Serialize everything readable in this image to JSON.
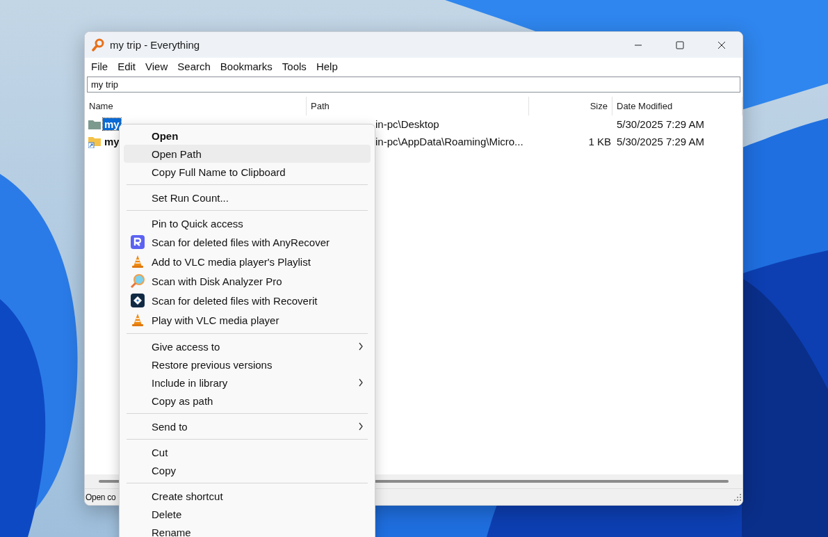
{
  "window": {
    "title": "my trip - Everything"
  },
  "menu_bar": [
    "File",
    "Edit",
    "View",
    "Search",
    "Bookmarks",
    "Tools",
    "Help"
  ],
  "search": {
    "value": "my trip"
  },
  "table": {
    "columns": [
      "Name",
      "Path",
      "Size",
      "Date Modified"
    ],
    "rows": [
      {
        "kind": "folder",
        "name": "my",
        "path": "in-pc\\Desktop",
        "size": "",
        "date": "5/30/2025 7:29 AM",
        "selected": true
      },
      {
        "kind": "shortcut",
        "name": "my",
        "path": "in-pc\\AppData\\Roaming\\Micro...",
        "size": "1 KB",
        "date": "5/30/2025 7:29 AM",
        "selected": false
      }
    ]
  },
  "status_bar": "Open co",
  "context_menu": [
    {
      "kind": "plain",
      "label": "Open",
      "default": true,
      "highlighted": false,
      "submenu": false
    },
    {
      "kind": "plain",
      "label": "Open Path",
      "default": false,
      "highlighted": true,
      "submenu": false
    },
    {
      "kind": "plain",
      "label": "Copy Full Name to Clipboard",
      "default": false,
      "highlighted": false,
      "submenu": false
    },
    {
      "kind": "separator"
    },
    {
      "kind": "plain",
      "label": "Set Run Count...",
      "default": false,
      "highlighted": false,
      "submenu": false
    },
    {
      "kind": "separator"
    },
    {
      "kind": "plain",
      "label": "Pin to Quick access",
      "default": false,
      "highlighted": false,
      "submenu": false
    },
    {
      "kind": "rtile",
      "label": "Scan for deleted files with AnyRecover",
      "default": false,
      "highlighted": false,
      "submenu": false
    },
    {
      "kind": "cone",
      "label": "Add to VLC media player's Playlist",
      "default": false,
      "highlighted": false,
      "submenu": false
    },
    {
      "kind": "magnifier",
      "label": "Scan with Disk Analyzer Pro",
      "default": false,
      "highlighted": false,
      "submenu": false
    },
    {
      "kind": "diamond",
      "label": "Scan for deleted files with Recoverit",
      "default": false,
      "highlighted": false,
      "submenu": false
    },
    {
      "kind": "cone",
      "label": "Play with VLC media player",
      "default": false,
      "highlighted": false,
      "submenu": false
    },
    {
      "kind": "separator"
    },
    {
      "kind": "plain",
      "label": "Give access to",
      "default": false,
      "highlighted": false,
      "submenu": true
    },
    {
      "kind": "plain",
      "label": "Restore previous versions",
      "default": false,
      "highlighted": false,
      "submenu": false
    },
    {
      "kind": "plain",
      "label": "Include in library",
      "default": false,
      "highlighted": false,
      "submenu": true
    },
    {
      "kind": "plain",
      "label": "Copy as path",
      "default": false,
      "highlighted": false,
      "submenu": false
    },
    {
      "kind": "separator"
    },
    {
      "kind": "plain",
      "label": "Send to",
      "default": false,
      "highlighted": false,
      "submenu": true
    },
    {
      "kind": "separator"
    },
    {
      "kind": "plain",
      "label": "Cut",
      "default": false,
      "highlighted": false,
      "submenu": false
    },
    {
      "kind": "plain",
      "label": "Copy",
      "default": false,
      "highlighted": false,
      "submenu": false
    },
    {
      "kind": "separator"
    },
    {
      "kind": "plain",
      "label": "Create shortcut",
      "default": false,
      "highlighted": false,
      "submenu": false
    },
    {
      "kind": "plain",
      "label": "Delete",
      "default": false,
      "highlighted": false,
      "submenu": false
    },
    {
      "kind": "plain",
      "label": "Rename",
      "default": false,
      "highlighted": false,
      "submenu": false
    }
  ]
}
